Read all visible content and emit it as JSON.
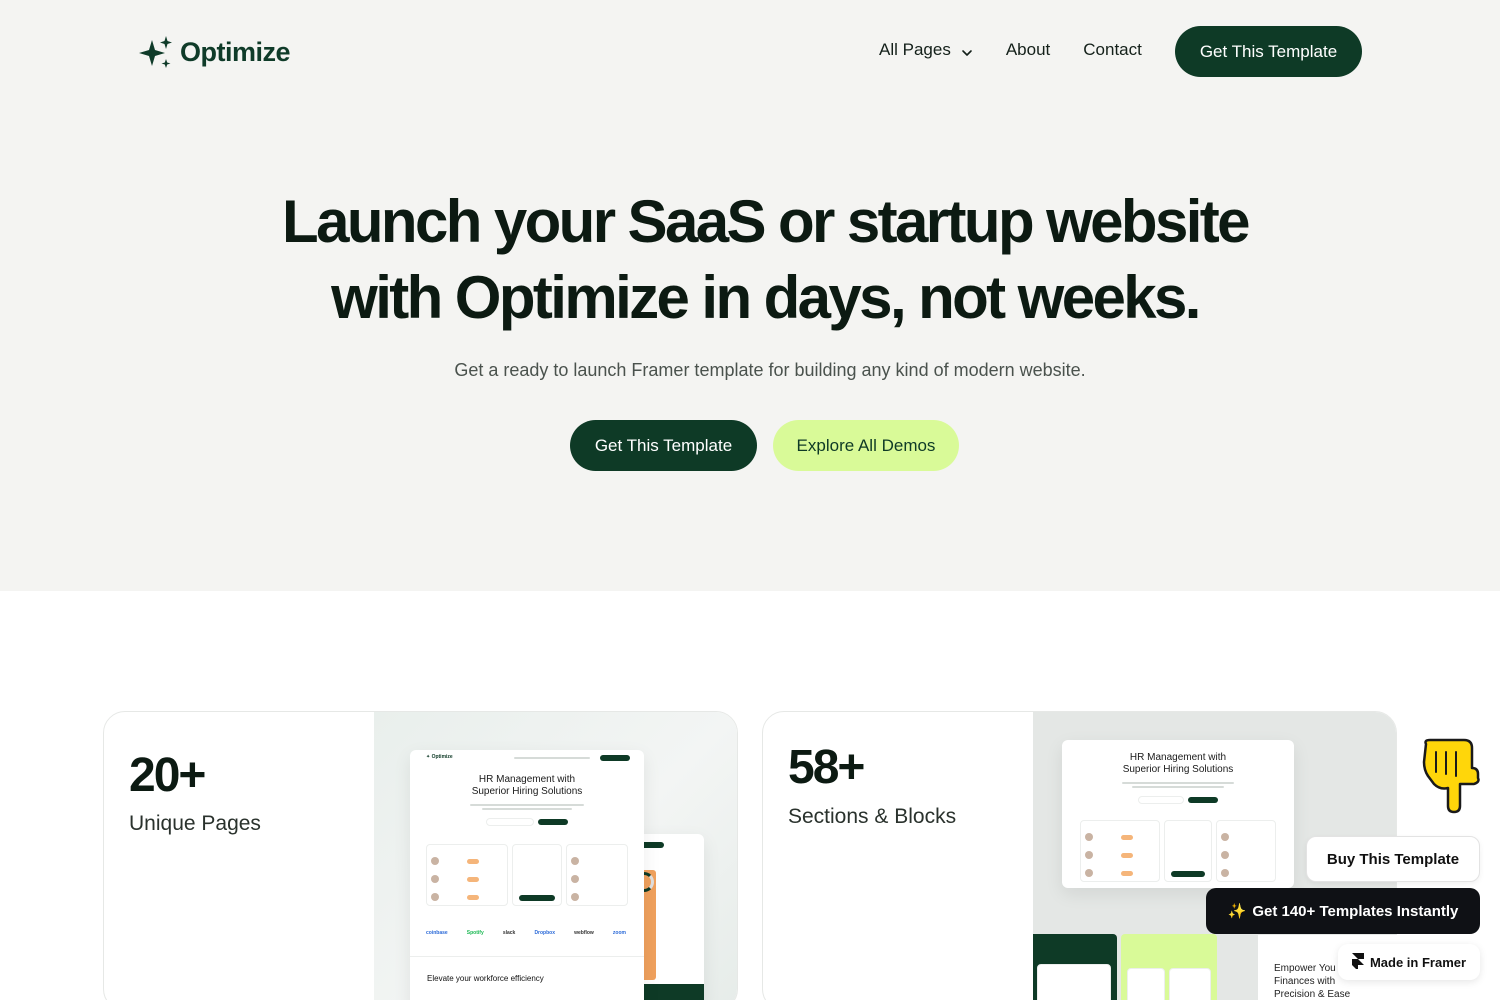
{
  "nav": {
    "logo_text": "Optimize",
    "links": [
      {
        "label": "All Pages",
        "has_dropdown": true
      },
      {
        "label": "About"
      },
      {
        "label": "Contact"
      }
    ],
    "cta_label": "Get This Template"
  },
  "hero": {
    "title_line1": "Launch your SaaS or startup website",
    "title_line2": "with Optimize in days, not weeks.",
    "subtitle": "Get a ready to launch Framer template for building any kind of modern website.",
    "primary_button": "Get This Template",
    "secondary_button": "Explore All Demos"
  },
  "stats": [
    {
      "number": "20+",
      "label": "Unique Pages"
    },
    {
      "number": "58+",
      "label": "Sections & Blocks"
    }
  ],
  "mockups": {
    "card1_title_line1": "HR Management with",
    "card1_title_line2": "Superior Hiring Solutions",
    "card1_section": "Elevate your workforce efficiency",
    "card1_logos": [
      "coinbase",
      "Spotify",
      "slack",
      "Dropbox",
      "webflow",
      "zoom"
    ],
    "card2_title_line1": "HR Management with",
    "card2_title_line2": "Superior Hiring Solutions"
  },
  "floating": {
    "buy_label": "Buy This Template",
    "get_templates_label": "Get 140+ Templates Instantly",
    "sparkle": "✨",
    "made_in_framer": "Made in Framer",
    "empower_line1": "Empower You",
    "empower_line2": "Finances with",
    "empower_line3": "Precision & Ease"
  },
  "colors": {
    "brand_dark": "#0e3a26",
    "accent_lime": "#d9fa98",
    "hero_bg": "#f4f4f2"
  },
  "icons": [
    "sparkle-logo-icon",
    "chevron-down-icon",
    "pointing-hand-icon",
    "framer-icon",
    "sparkles-emoji-icon"
  ]
}
